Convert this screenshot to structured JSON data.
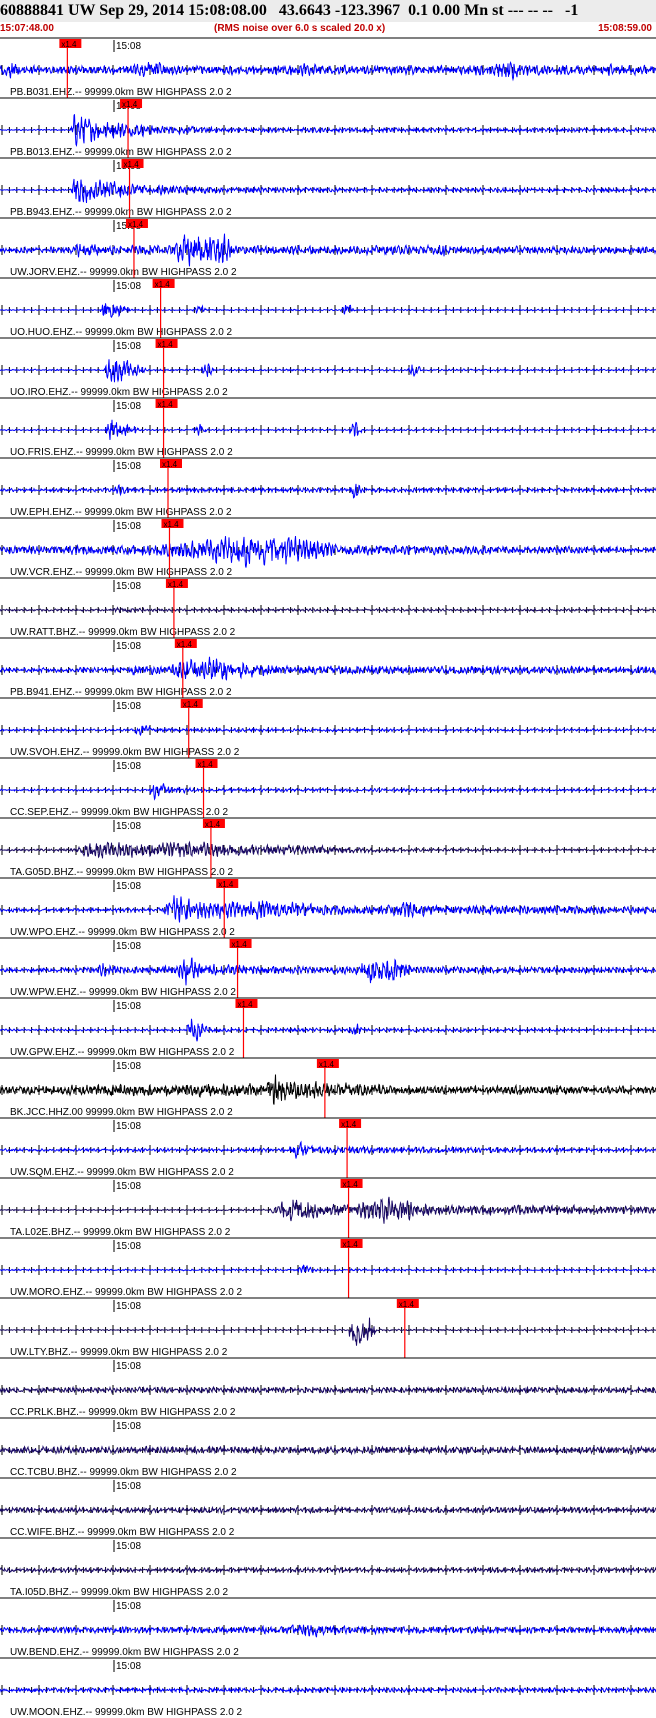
{
  "header": {
    "title": "60888841 UW Sep 29, 2014 15:08:08.00   43.6643 -123.3967  0.1 0.00 Mn st --- -- --   -1",
    "start_time": "15:07:48.00",
    "noise_note": "(RMS noise over 6.0 s scaled 20.0 x)",
    "end_time": "15:08:59.00"
  },
  "chart_data": {
    "type": "line",
    "x_start": "15:07:48.00",
    "x_end": "15:08:59.00",
    "minute_label": "15:08",
    "pick_label": "x1.4",
    "grid": false,
    "series": [
      {
        "name": "PB.B031.EHZ.-- 99999.0km BW  HIGHPASS  2.0  2",
        "color": "#0000ff",
        "pick_s": 1.4,
        "env": [
          [
            0,
            0.22
          ],
          [
            2,
            0.6
          ],
          [
            3,
            0.22
          ],
          [
            18,
            0.28
          ],
          [
            21,
            0.6
          ],
          [
            23,
            0.25
          ],
          [
            33,
            0.25
          ],
          [
            41,
            0.35
          ],
          [
            44,
            0.25
          ],
          [
            66,
            0.3
          ],
          [
            69,
            0.7
          ],
          [
            72,
            0.3
          ],
          [
            88,
            0.3
          ]
        ]
      },
      {
        "name": "PB.B013.EHZ.-- 99999.0km BW  HIGHPASS  2.0  2",
        "color": "#0000ff",
        "pick_s": 9.6,
        "env": [
          [
            0,
            0.03
          ],
          [
            9.5,
            0.04
          ],
          [
            10,
            0.9
          ],
          [
            14,
            0.55
          ],
          [
            20,
            0.3
          ],
          [
            30,
            0.15
          ],
          [
            45,
            0.12
          ],
          [
            88,
            0.1
          ]
        ]
      },
      {
        "name": "PB.B943.EHZ.-- 99999.0km BW  HIGHPASS  2.0  2",
        "color": "#0000ff",
        "pick_s": 9.8,
        "env": [
          [
            0,
            0.03
          ],
          [
            9.5,
            0.05
          ],
          [
            10,
            0.95
          ],
          [
            14,
            0.55
          ],
          [
            20,
            0.3
          ],
          [
            30,
            0.15
          ],
          [
            45,
            0.12
          ],
          [
            88,
            0.1
          ]
        ]
      },
      {
        "name": "UW.JORV.EHZ.-- 99999.0km BW  HIGHPASS  2.0  2",
        "color": "#0000ff",
        "pick_s": 10.4,
        "env": [
          [
            0,
            0.15
          ],
          [
            10,
            0.2
          ],
          [
            11,
            0.55
          ],
          [
            14,
            0.25
          ],
          [
            23,
            0.25
          ],
          [
            25,
            0.98
          ],
          [
            30,
            0.98
          ],
          [
            32,
            0.25
          ],
          [
            59,
            0.25
          ],
          [
            60,
            0.45
          ],
          [
            61,
            0.2
          ],
          [
            88,
            0.2
          ]
        ]
      },
      {
        "name": "UO.HUO.EHZ.-- 99999.0km BW  HIGHPASS  2.0  2",
        "color": "#0000ff",
        "pick_s": 14.0,
        "env": [
          [
            0,
            0.03
          ],
          [
            13.5,
            0.03
          ],
          [
            14,
            0.7
          ],
          [
            17,
            0.3
          ],
          [
            18,
            0.04
          ],
          [
            26,
            0.04
          ],
          [
            27,
            0.4
          ],
          [
            28,
            0.04
          ],
          [
            46,
            0.04
          ],
          [
            47,
            0.5
          ],
          [
            48,
            0.04
          ],
          [
            88,
            0.04
          ]
        ]
      },
      {
        "name": "UO.IRO.EHZ.-- 99999.0km BW  HIGHPASS  2.0  2",
        "color": "#0000ff",
        "pick_s": 14.4,
        "env": [
          [
            0,
            0.04
          ],
          [
            14,
            0.04
          ],
          [
            15,
            0.85
          ],
          [
            19,
            0.3
          ],
          [
            20,
            0.05
          ],
          [
            27,
            0.05
          ],
          [
            28,
            0.5
          ],
          [
            29,
            0.05
          ],
          [
            55,
            0.05
          ],
          [
            56,
            0.5
          ],
          [
            57,
            0.05
          ],
          [
            88,
            0.05
          ]
        ]
      },
      {
        "name": "UO.FRIS.EHZ.-- 99999.0km BW  HIGHPASS  2.0  2",
        "color": "#0000ff",
        "pick_s": 14.4,
        "env": [
          [
            0,
            0.04
          ],
          [
            14,
            0.04
          ],
          [
            15,
            0.8
          ],
          [
            18,
            0.3
          ],
          [
            19,
            0.05
          ],
          [
            26,
            0.05
          ],
          [
            27,
            0.45
          ],
          [
            28,
            0.05
          ],
          [
            47,
            0.05
          ],
          [
            48,
            0.55
          ],
          [
            49,
            0.05
          ],
          [
            88,
            0.05
          ]
        ]
      },
      {
        "name": "UW.EPH.EHZ.-- 99999.0km BW  HIGHPASS  2.0  2",
        "color": "#0000ff",
        "pick_s": 15.0,
        "env": [
          [
            0,
            0.08
          ],
          [
            15,
            0.1
          ],
          [
            16,
            0.3
          ],
          [
            18,
            0.12
          ],
          [
            47,
            0.12
          ],
          [
            48,
            0.6
          ],
          [
            49,
            0.12
          ],
          [
            88,
            0.1
          ]
        ]
      },
      {
        "name": "UW.VCR.EHZ.-- 99999.0km BW  HIGHPASS  2.0  2",
        "color": "#0000ff",
        "pick_s": 15.2,
        "env": [
          [
            0,
            0.2
          ],
          [
            15,
            0.3
          ],
          [
            20,
            0.3
          ],
          [
            27,
            0.6
          ],
          [
            33,
            0.9
          ],
          [
            38,
            0.95
          ],
          [
            42,
            0.6
          ],
          [
            47,
            0.3
          ],
          [
            88,
            0.15
          ]
        ]
      },
      {
        "name": "UW.RATT.BHZ.-- 99999.0km BW  HIGHPASS  2.0  2",
        "color": "#1a0a66",
        "pick_s": 15.8,
        "env": [
          [
            0,
            0.06
          ],
          [
            15,
            0.08
          ],
          [
            16,
            0.15
          ],
          [
            20,
            0.08
          ],
          [
            88,
            0.06
          ]
        ]
      },
      {
        "name": "PB.B941.EHZ.-- 99999.0km BW  HIGHPASS  2.0  2",
        "color": "#0000ff",
        "pick_s": 17.0,
        "env": [
          [
            0,
            0.12
          ],
          [
            17,
            0.15
          ],
          [
            18,
            0.3
          ],
          [
            22,
            0.2
          ],
          [
            24,
            0.5
          ],
          [
            29,
            0.8
          ],
          [
            32,
            0.5
          ],
          [
            38,
            0.25
          ],
          [
            88,
            0.2
          ]
        ]
      },
      {
        "name": "UW.SVOH.EHZ.-- 99999.0km BW  HIGHPASS  2.0  2",
        "color": "#0000ff",
        "pick_s": 17.8,
        "env": [
          [
            0,
            0.06
          ],
          [
            18,
            0.06
          ],
          [
            18.5,
            0.35
          ],
          [
            21,
            0.1
          ],
          [
            88,
            0.06
          ]
        ]
      },
      {
        "name": "CC.SEP.EHZ.-- 99999.0km BW  HIGHPASS  2.0  2",
        "color": "#0000ff",
        "pick_s": 19.8,
        "env": [
          [
            0,
            0.06
          ],
          [
            20,
            0.06
          ],
          [
            21,
            0.6
          ],
          [
            23,
            0.25
          ],
          [
            26,
            0.1
          ],
          [
            88,
            0.06
          ]
        ]
      },
      {
        "name": "TA.G05D.BHZ.-- 99999.0km BW  HIGHPASS  2.0  2",
        "color": "#1a0a66",
        "pick_s": 20.8,
        "env": [
          [
            0,
            0.05
          ],
          [
            10,
            0.08
          ],
          [
            12,
            0.45
          ],
          [
            20,
            0.4
          ],
          [
            26,
            0.5
          ],
          [
            34,
            0.35
          ],
          [
            45,
            0.2
          ],
          [
            52,
            0.1
          ],
          [
            88,
            0.05
          ]
        ]
      },
      {
        "name": "UW.WPO.EHZ.-- 99999.0km BW  HIGHPASS  2.0  2",
        "color": "#0000ff",
        "pick_s": 22.6,
        "env": [
          [
            0,
            0.1
          ],
          [
            22,
            0.12
          ],
          [
            23,
            0.85
          ],
          [
            28,
            0.5
          ],
          [
            37,
            0.55
          ],
          [
            44,
            0.3
          ],
          [
            52,
            0.25
          ],
          [
            55,
            0.55
          ],
          [
            58,
            0.3
          ],
          [
            88,
            0.2
          ]
        ]
      },
      {
        "name": "UW.WPW.EHZ.-- 99999.0km BW  HIGHPASS  2.0  2",
        "color": "#0000ff",
        "pick_s": 24.4,
        "env": [
          [
            0,
            0.1
          ],
          [
            13,
            0.15
          ],
          [
            14,
            0.45
          ],
          [
            16,
            0.2
          ],
          [
            24,
            0.25
          ],
          [
            25,
            0.9
          ],
          [
            28,
            0.35
          ],
          [
            40,
            0.2
          ],
          [
            48,
            0.2
          ],
          [
            50,
            0.8
          ],
          [
            53,
            0.7
          ],
          [
            56,
            0.2
          ],
          [
            88,
            0.15
          ]
        ]
      },
      {
        "name": "UW.GPW.EHZ.-- 99999.0km BW  HIGHPASS  2.0  2",
        "color": "#0000ff",
        "pick_s": 25.2,
        "env": [
          [
            0,
            0.06
          ],
          [
            25,
            0.06
          ],
          [
            26,
            0.85
          ],
          [
            28,
            0.2
          ],
          [
            30,
            0.1
          ],
          [
            47,
            0.1
          ],
          [
            48,
            0.5
          ],
          [
            49,
            0.1
          ],
          [
            88,
            0.06
          ]
        ]
      },
      {
        "name": "BK.JCC.HHZ.00 99999.0km BW  HIGHPASS  2.0  2",
        "color": "#000000",
        "pick_s": 36.2,
        "env": [
          [
            0,
            0.25
          ],
          [
            20,
            0.35
          ],
          [
            36,
            0.4
          ],
          [
            37,
            0.98
          ],
          [
            39,
            0.6
          ],
          [
            44,
            0.45
          ],
          [
            55,
            0.25
          ],
          [
            88,
            0.2
          ]
        ]
      },
      {
        "name": "UW.SQM.EHZ.-- 99999.0km BW  HIGHPASS  2.0  2",
        "color": "#0000ff",
        "pick_s": 39.2,
        "env": [
          [
            0,
            0.08
          ],
          [
            39,
            0.1
          ],
          [
            40,
            0.6
          ],
          [
            42,
            0.2
          ],
          [
            88,
            0.08
          ]
        ]
      },
      {
        "name": "TA.L02E.BHZ.-- 99999.0km BW  HIGHPASS  2.0  2",
        "color": "#1a0a66",
        "pick_s": 39.4,
        "env": [
          [
            0,
            0.03
          ],
          [
            36,
            0.05
          ],
          [
            40,
            0.8
          ],
          [
            43,
            0.4
          ],
          [
            48,
            0.35
          ],
          [
            52,
            0.9
          ],
          [
            56,
            0.5
          ],
          [
            60,
            0.3
          ],
          [
            88,
            0.2
          ]
        ]
      },
      {
        "name": "UW.MORO.EHZ.-- 99999.0km BW  HIGHPASS  2.0  2",
        "color": "#0000ff",
        "pick_s": 39.4,
        "env": [
          [
            0,
            0.05
          ],
          [
            40,
            0.05
          ],
          [
            41,
            0.3
          ],
          [
            43,
            0.06
          ],
          [
            88,
            0.05
          ]
        ]
      },
      {
        "name": "UW.LTY.BHZ.-- 99999.0km BW  HIGHPASS  2.0  2",
        "color": "#1a0a66",
        "pick_s": 47.0,
        "env": [
          [
            0,
            0.03
          ],
          [
            47,
            0.04
          ],
          [
            47.5,
            0.95
          ],
          [
            50,
            0.9
          ],
          [
            51,
            0.05
          ],
          [
            88,
            0.05
          ]
        ]
      },
      {
        "name": "CC.PRLK.BHZ.-- 99999.0km BW  HIGHPASS  2.0  2",
        "color": "#1a0a66",
        "pick_s": null,
        "env": [
          [
            0,
            0.15
          ],
          [
            88,
            0.15
          ]
        ]
      },
      {
        "name": "CC.TCBU.BHZ.-- 99999.0km BW  HIGHPASS  2.0  2",
        "color": "#1a0a66",
        "pick_s": null,
        "env": [
          [
            0,
            0.2
          ],
          [
            88,
            0.18
          ]
        ]
      },
      {
        "name": "CC.WIFE.BHZ.-- 99999.0km BW  HIGHPASS  2.0  2",
        "color": "#1a0a66",
        "pick_s": null,
        "env": [
          [
            0,
            0.15
          ],
          [
            88,
            0.15
          ]
        ]
      },
      {
        "name": "TA.I05D.BHZ.-- 99999.0km BW  HIGHPASS  2.0  2",
        "color": "#1a0a66",
        "pick_s": null,
        "env": [
          [
            0,
            0.12
          ],
          [
            88,
            0.12
          ]
        ]
      },
      {
        "name": "UW.BEND.EHZ.-- 99999.0km BW  HIGHPASS  2.0  2",
        "color": "#0000ff",
        "pick_s": null,
        "env": [
          [
            0,
            0.15
          ],
          [
            38,
            0.2
          ],
          [
            42,
            0.4
          ],
          [
            46,
            0.2
          ],
          [
            88,
            0.15
          ]
        ]
      },
      {
        "name": "UW.MOON.EHZ.-- 99999.0km BW  HIGHPASS  2.0  2",
        "color": "#0000ff",
        "pick_s": null,
        "env": [
          [
            0,
            0.12
          ],
          [
            88,
            0.12
          ]
        ]
      }
    ]
  }
}
